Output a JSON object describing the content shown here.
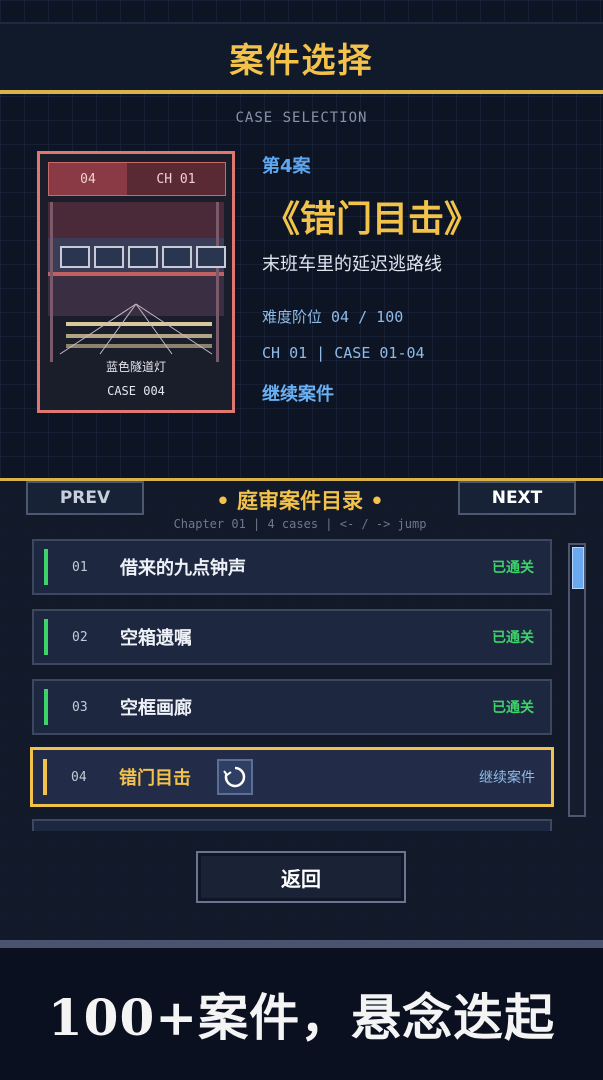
{
  "header": {
    "title": "案件选择",
    "subtitle": "CASE SELECTION"
  },
  "cover": {
    "tab_number": "04",
    "tab_chapter": "CH 01",
    "scene_name": "蓝色隧道灯",
    "case_code": "CASE 004"
  },
  "detail": {
    "case_number": "第4案",
    "case_title": "《错门目击》",
    "tagline": "末班车里的延迟逃路线",
    "difficulty": "难度阶位 04 / 100",
    "chapter_line": "CH 01  |  CASE 01-04",
    "continue_label": "继续案件"
  },
  "directory": {
    "prev_label": "PREV",
    "next_label": "NEXT",
    "title": "• 庭审案件目录 •",
    "hint": "Chapter 01  |  4 cases  |  <- / -> jump",
    "rows": [
      {
        "num": "01",
        "title": "借来的九点钟声",
        "status": "已通关"
      },
      {
        "num": "02",
        "title": "空箱遗嘱",
        "status": "已通关"
      },
      {
        "num": "03",
        "title": "空框画廊",
        "status": "已通关"
      },
      {
        "num": "04",
        "title": "错门目击",
        "status": "继续案件"
      }
    ]
  },
  "back_label": "返回",
  "banner_text": "100+案件，悬念迭起",
  "colors": {
    "accent_gold": "#f2c24b",
    "cleared_green": "#3ed26a",
    "link_blue": "#6ab0f5",
    "cover_border": "#e07872"
  }
}
